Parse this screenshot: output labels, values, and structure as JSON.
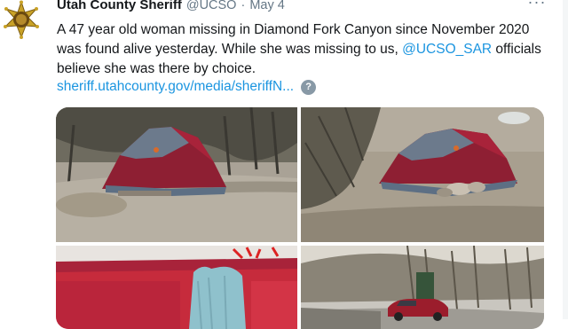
{
  "tweet": {
    "author": {
      "display_name": "Utah County Sheriff",
      "handle": "@UCSO",
      "avatar_icon": "sheriff-star-badge-icon"
    },
    "separator": "·",
    "date": "May 4",
    "more_icon": "more-dots-icon",
    "more_glyph": "···",
    "text_part1": "A 47 year old woman missing in Diamond Fork Canyon since November 2020 was found alive yesterday. While she was missing to us, ",
    "mention": "@UCSO_SAR",
    "text_part2": " officials believe she was there by choice.",
    "link": "sheriff.utahcounty.gov/media/sheriffN...",
    "help_glyph": "?",
    "help_icon": "question-circle-icon",
    "photos": [
      {
        "name": "red-tent-wide-photo"
      },
      {
        "name": "red-tent-closeup-photo"
      },
      {
        "name": "tent-interior-towel-photo"
      },
      {
        "name": "canyon-road-car-photo"
      }
    ]
  },
  "colors": {
    "link": "#1b95e0",
    "text": "#14171a",
    "secondary": "#657786",
    "tent_red": "#a8233a",
    "tent_gray": "#6c7a8c"
  }
}
